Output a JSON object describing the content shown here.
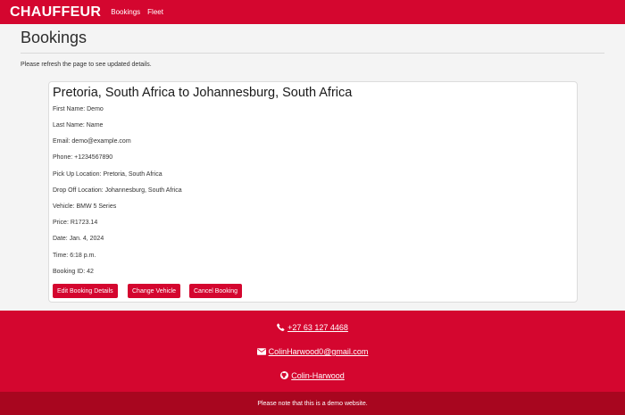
{
  "navbar": {
    "brand": "CHAUFFEUR",
    "links": [
      "Bookings",
      "Fleet"
    ]
  },
  "page": {
    "title": "Bookings",
    "notice": "Please refresh the page to see updated details."
  },
  "booking": {
    "title": "Pretoria, South Africa to Johannesburg, South Africa",
    "details": [
      {
        "label": "First Name:",
        "value": "Demo"
      },
      {
        "label": "Last Name:",
        "value": "Name"
      },
      {
        "label": "Email:",
        "value": "demo@example.com"
      },
      {
        "label": "Phone:",
        "value": "+1234567890"
      },
      {
        "label": "Pick Up Location:",
        "value": "Pretoria, South Africa"
      },
      {
        "label": "Drop Off Location:",
        "value": "Johannesburg, South Africa"
      },
      {
        "label": "Vehicle:",
        "value": "BMW 5 Series"
      },
      {
        "label": "Price:",
        "value": "R1723.14"
      },
      {
        "label": "Date:",
        "value": "Jan. 4, 2024"
      },
      {
        "label": "Time:",
        "value": "6:18 p.m."
      },
      {
        "label": "Booking ID:",
        "value": "42"
      }
    ],
    "buttons": {
      "edit": "Edit Booking Details",
      "change_vehicle": "Change Vehicle",
      "cancel": "Cancel Booking"
    }
  },
  "footer": {
    "phone": "+27 63 127 4468",
    "email": "ColinHarwood0@gmail.com",
    "github": "Colin-Harwood",
    "icons": [
      "phone-icon",
      "envelope-icon",
      "github-icon"
    ],
    "disclaimer": "Please note that this is a demo website."
  },
  "colors": {
    "accent": "#d4062f",
    "footer_bottom": "#a8061f"
  }
}
